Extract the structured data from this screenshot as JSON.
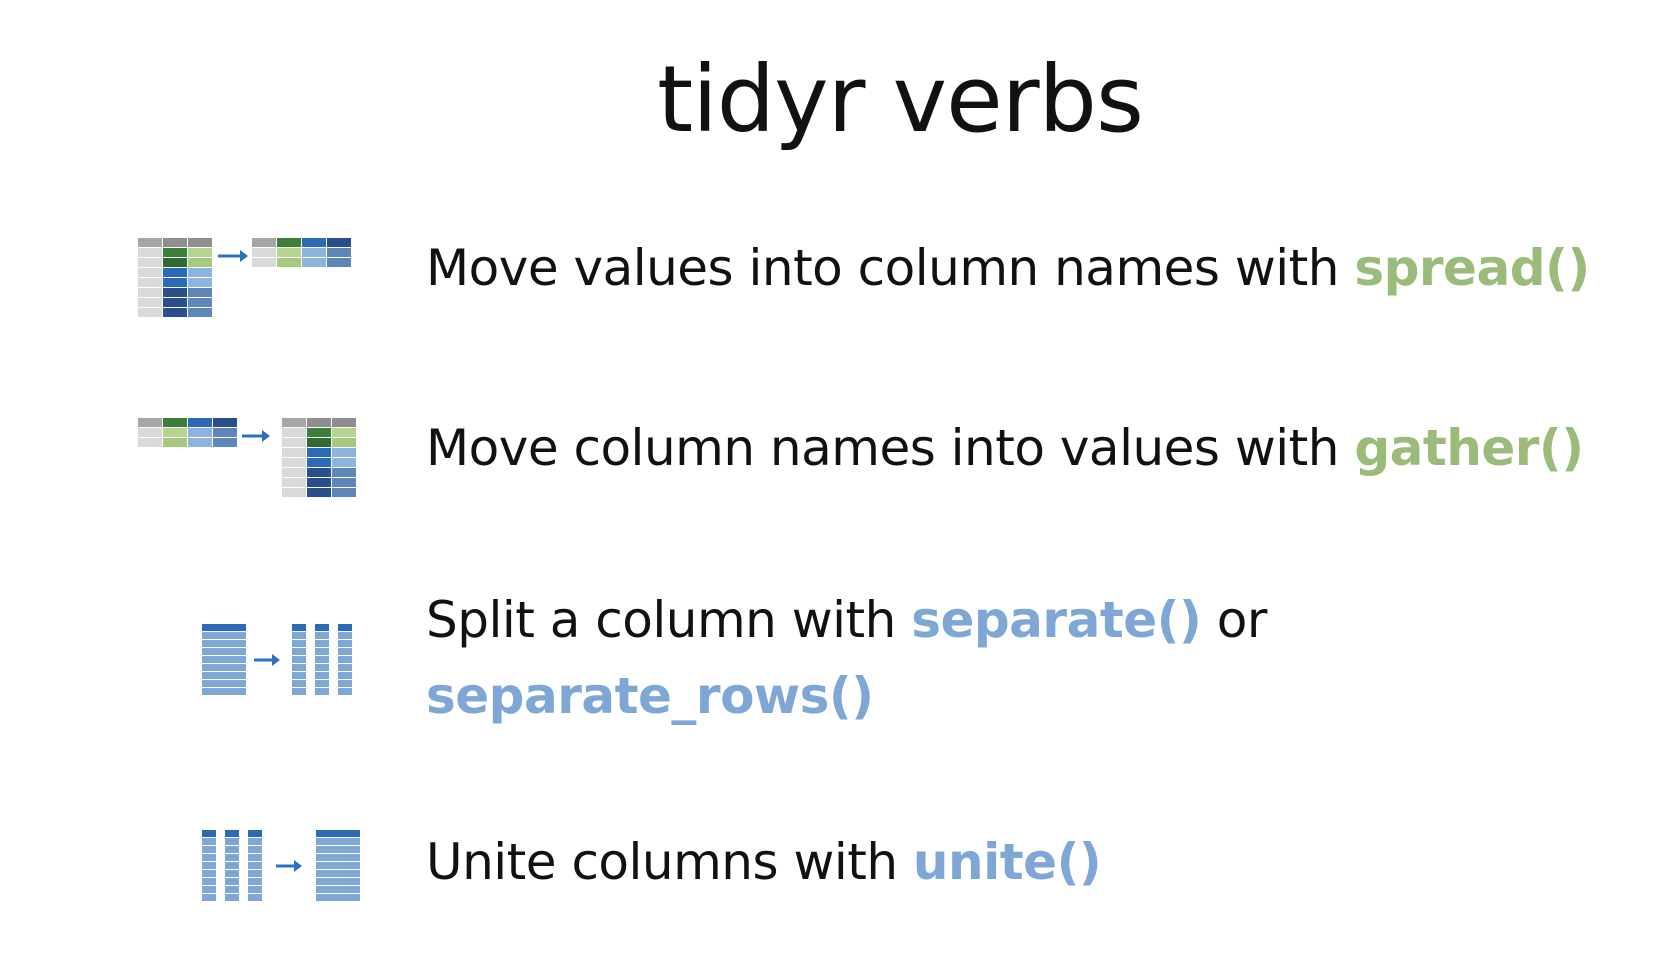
{
  "title": "tidyr verbs",
  "colors": {
    "green": "#9bbb7a",
    "blue": "#7ea7d6",
    "text": "#111111",
    "arrow": "#2e6fc2"
  },
  "rows": [
    {
      "icon": "spread-table-icon",
      "lead": "Move values into column names with ",
      "fn": "spread()",
      "fn_color": "green"
    },
    {
      "icon": "gather-table-icon",
      "lead": "Move column names into values with ",
      "fn": "gather()",
      "fn_color": "green"
    },
    {
      "icon": "separate-columns-icon",
      "lead": "Split a column with ",
      "fn": "separate()",
      "mid": " or",
      "fn2": "separate_rows()",
      "fn_color": "blue"
    },
    {
      "icon": "unite-columns-icon",
      "lead": "Unite columns with ",
      "fn": "unite()",
      "fn_color": "blue"
    }
  ]
}
